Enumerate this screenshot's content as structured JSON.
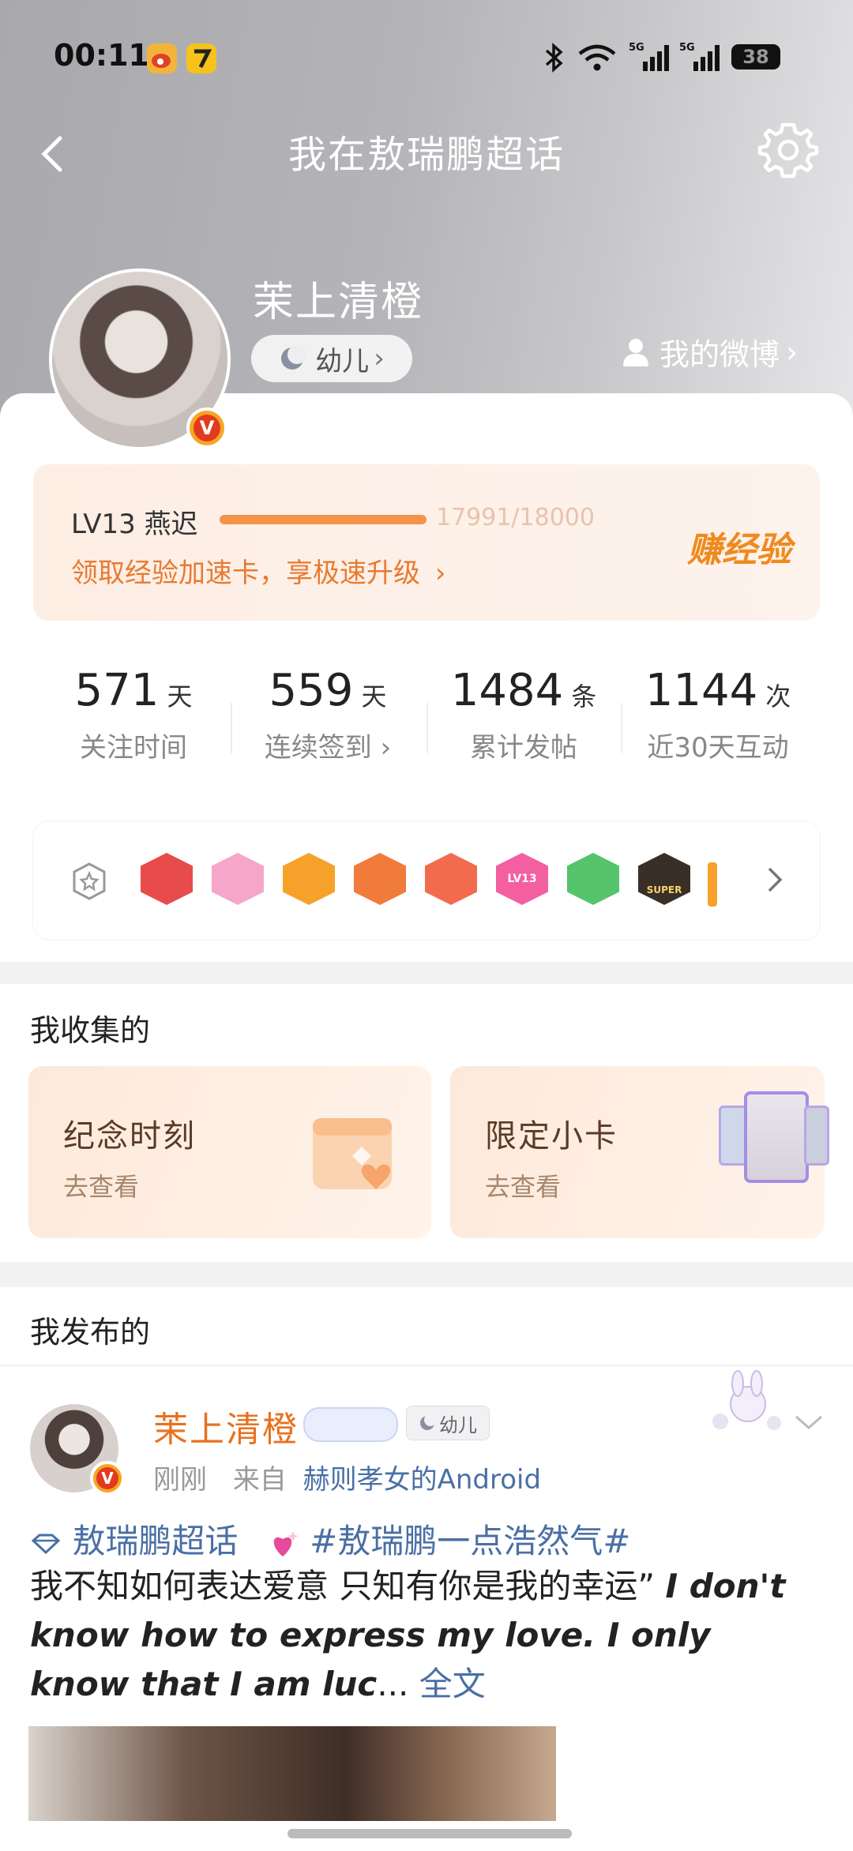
{
  "status_bar": {
    "time": "00:11",
    "network_1": "5G",
    "network_2": "5G",
    "battery": "38"
  },
  "nav": {
    "title": "我在敖瑞鹏超话"
  },
  "profile": {
    "username": "茉上清橙",
    "rank": "幼儿",
    "my_weibo": "我的微博"
  },
  "level": {
    "label": "LV13 燕迟",
    "progress_text": "17991/18000",
    "progress_fraction": 0.9995,
    "tip": "领取经验加速卡，享极速升级",
    "earn_label": "赚经验"
  },
  "stats": [
    {
      "value": "571",
      "unit": "天",
      "label": "关注时间"
    },
    {
      "value": "559",
      "unit": "天",
      "label": "连续签到"
    },
    {
      "value": "1484",
      "unit": "条",
      "label": "累计发帖"
    },
    {
      "value": "1144",
      "unit": "次",
      "label": "近30天互动"
    }
  ],
  "badges": {
    "items": [
      "trophy-badge",
      "character-badge",
      "crown-badge",
      "fox-badge",
      "smile-badge",
      "lv13-badge",
      "hand-badge",
      "super-badge"
    ],
    "colors": [
      "#e84b4b",
      "#f6a6c9",
      "#f5a12a",
      "#f07b3a",
      "#f26b4d",
      "#f35fa0",
      "#55c46a",
      "#3a2f26"
    ],
    "lv_badge_text": "LV13",
    "super_badge_text": "SUPER"
  },
  "collections": {
    "title": "我收集的",
    "cards": [
      {
        "title": "纪念时刻",
        "sub": "去查看"
      },
      {
        "title": "限定小卡",
        "sub": "去查看"
      }
    ]
  },
  "posts": {
    "title": "我发布的",
    "item": {
      "author": "茉上清橙",
      "rank": "幼儿",
      "time": "刚刚",
      "from_label": "来自",
      "device": "赫则孝女的Android",
      "topic": "敖瑞鹏超话",
      "hashtag": "#敖瑞鹏一点浩然气#",
      "text_cn": "我不知如何表达爱意 只知有你是我的幸运”",
      "text_en": "I don't know how to express my love. I only know that I am luc",
      "ellipsis": "...",
      "more": "全文"
    }
  },
  "colors": {
    "accent_orange": "#e8711e",
    "link_blue": "#4a6fa5",
    "vip_red": "#e23a1e"
  }
}
